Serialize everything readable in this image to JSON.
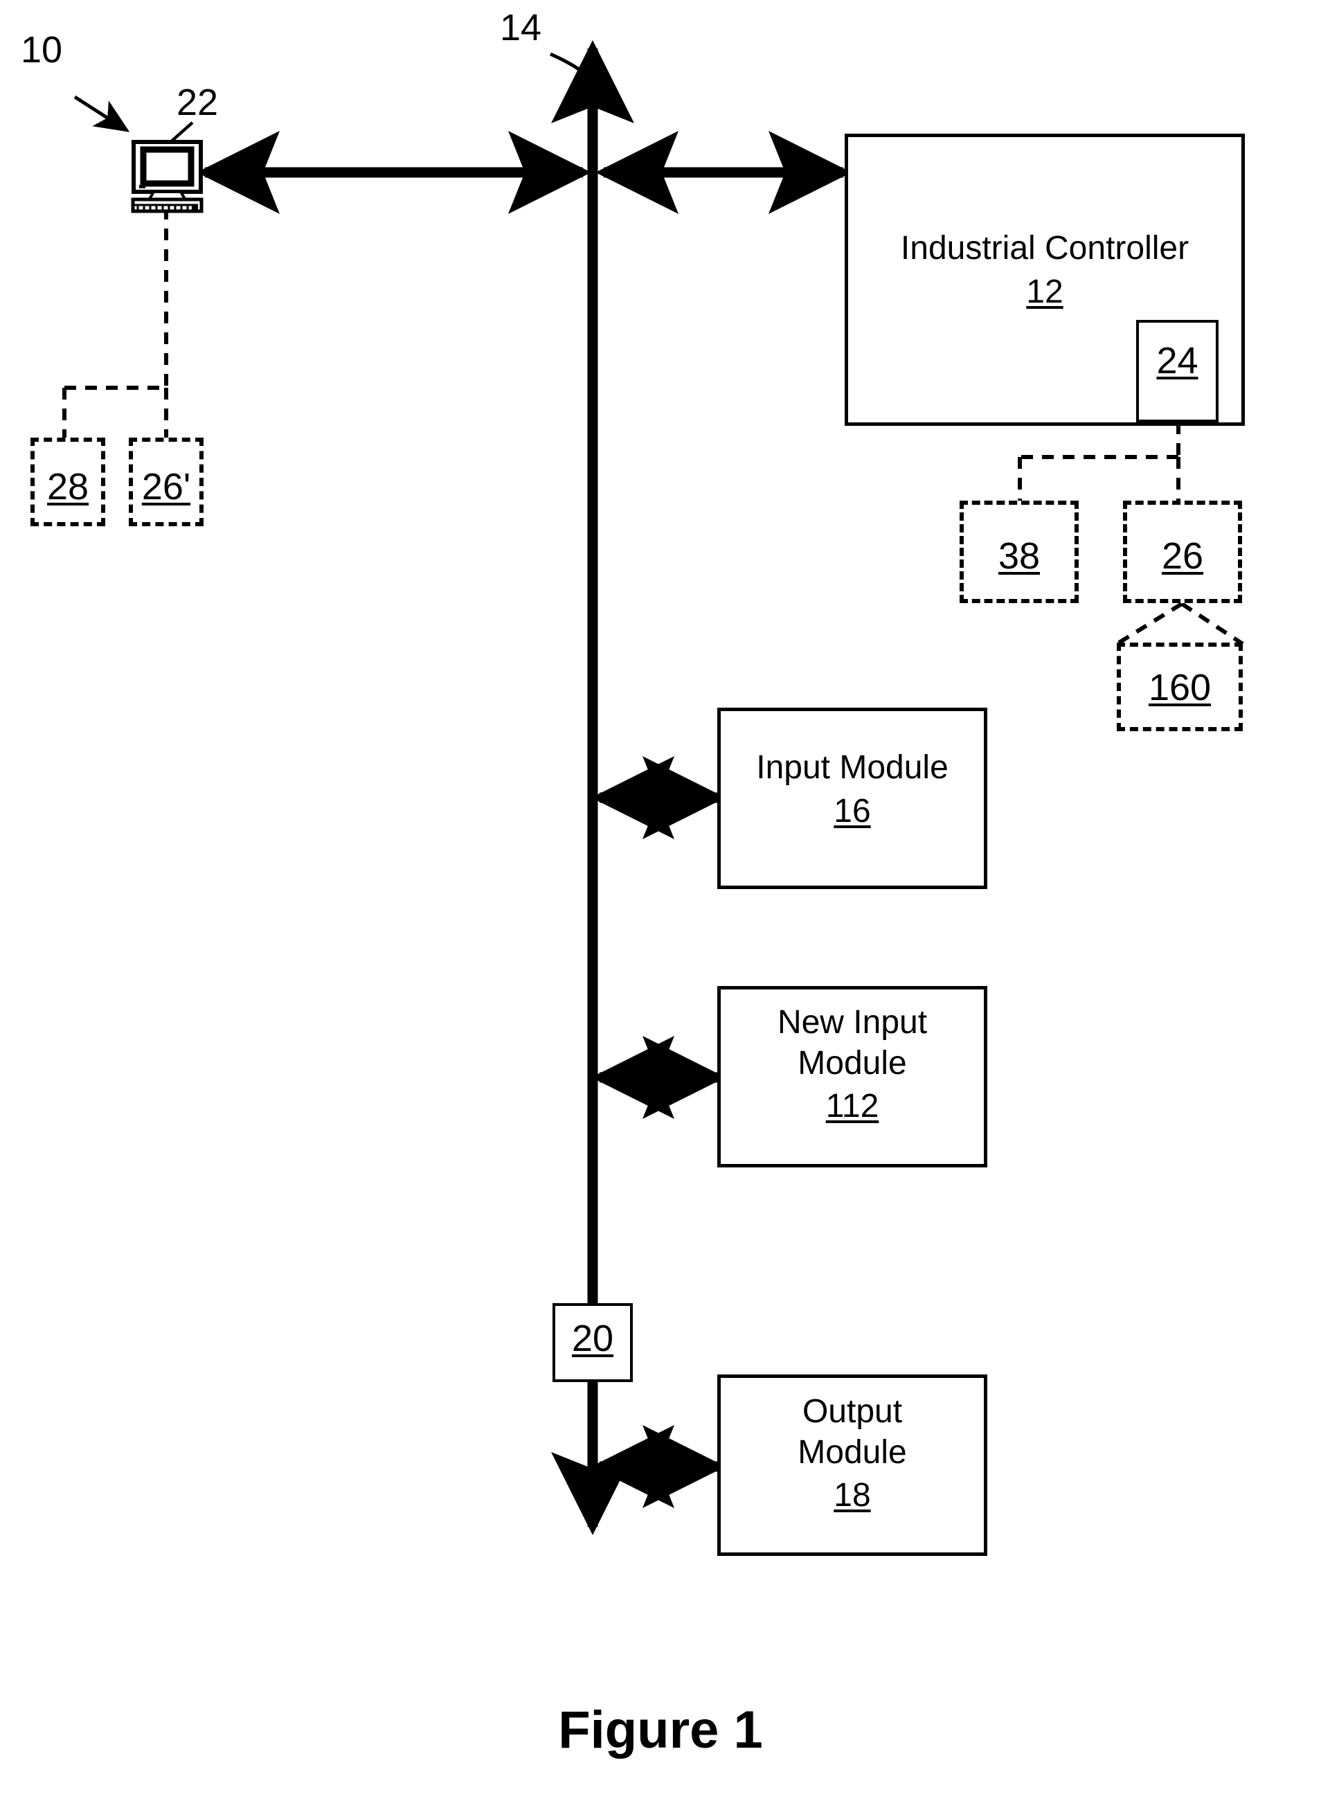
{
  "figure": {
    "caption": "Figure 1",
    "system_ref": "10",
    "bus_ref": "14"
  },
  "nodes": {
    "workstation": {
      "ref": "22",
      "icon": "desktop-computer-icon"
    },
    "industrial_controller": {
      "label": "Industrial Controller",
      "ref": "12",
      "inner_module_ref": "24"
    },
    "input_module": {
      "label": "Input Module",
      "ref": "16"
    },
    "new_input_module": {
      "label_line1": "New Input",
      "label_line2": "Module",
      "ref": "112"
    },
    "output_module": {
      "label_line1": "Output",
      "label_line2": "Module",
      "ref": "18"
    },
    "bus_node": {
      "ref": "20"
    }
  },
  "dashed_nodes": {
    "left": [
      {
        "ref": "28"
      },
      {
        "ref": "26'"
      }
    ],
    "right": [
      {
        "ref": "38"
      },
      {
        "ref": "26"
      },
      {
        "ref": "160"
      }
    ]
  },
  "colors": {
    "ink": "#000000",
    "paper": "#ffffff"
  }
}
